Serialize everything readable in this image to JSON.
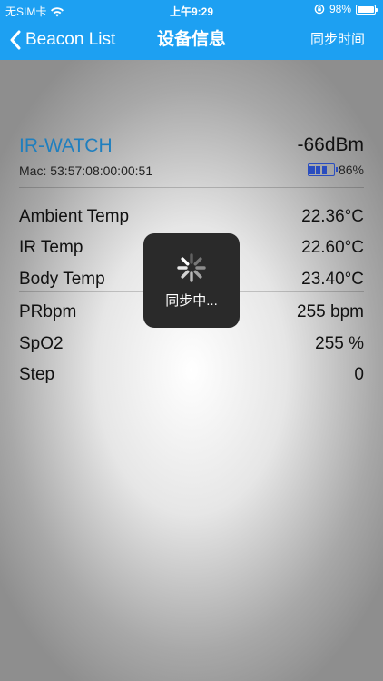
{
  "status_bar": {
    "carrier": "无SIM卡",
    "time": "上午9:29",
    "battery": "98%",
    "battery_level": 0.98
  },
  "nav": {
    "back_label": "Beacon List",
    "title": "设备信息",
    "right_action": "同步时间"
  },
  "device": {
    "name": "IR-WATCH",
    "rssi": "-66dBm",
    "mac": "Mac: 53:57:08:00:00:51",
    "battery": "86%",
    "battery_level": 0.86
  },
  "readings": [
    {
      "label": "Ambient Temp",
      "value": "22.36°C"
    },
    {
      "label": "IR Temp",
      "value": "22.60°C"
    },
    {
      "label": "Body Temp",
      "value": "23.40°C"
    },
    {
      "label": "PRbpm",
      "value": "255 bpm"
    },
    {
      "label": "SpO2",
      "value": "255 %"
    },
    {
      "label": "Step",
      "value": "0"
    }
  ],
  "hud": {
    "message": "同步中..."
  },
  "colors": {
    "accent": "#1da0f2",
    "device_name": "#1f7fbf",
    "battery_icon": "#2a4dbf"
  },
  "icons": [
    "wifi-icon",
    "back-chevron-icon",
    "orientation-lock-icon",
    "battery-icon",
    "spinner-icon"
  ]
}
